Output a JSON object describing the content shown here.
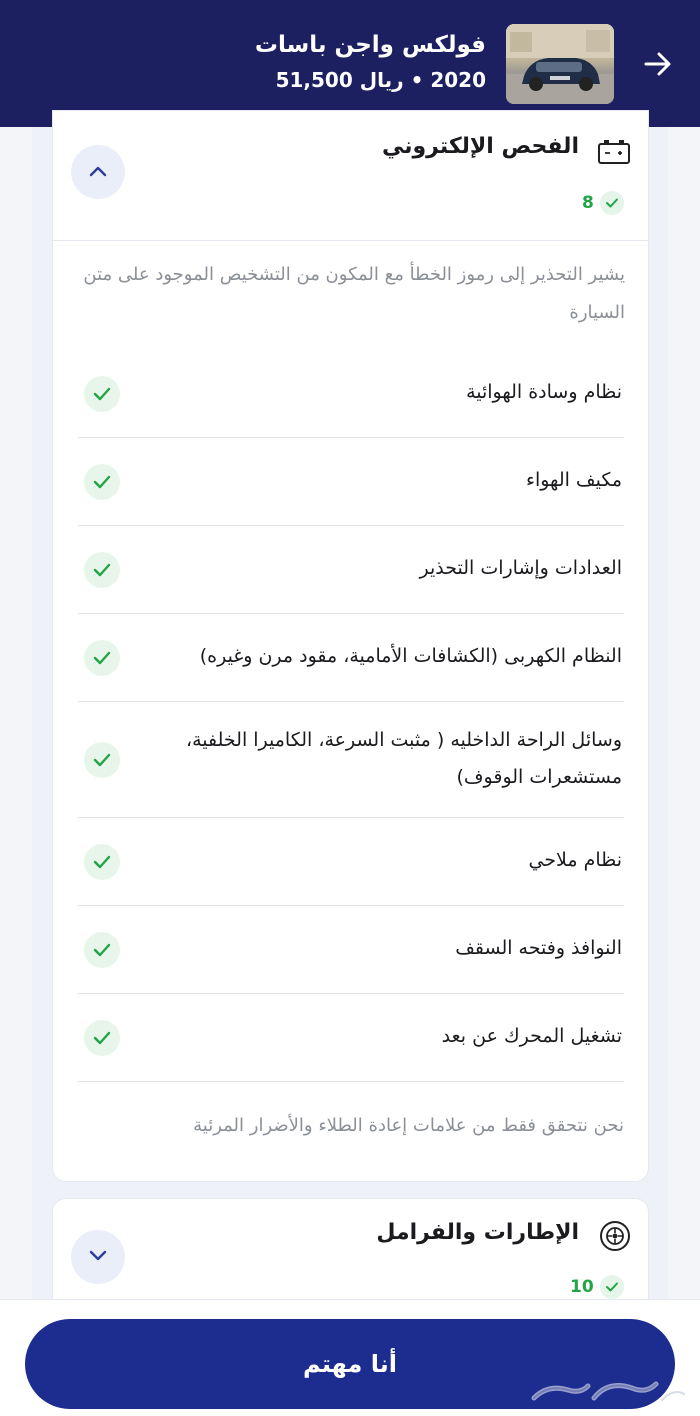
{
  "header": {
    "title": "فولكس واجن باسات",
    "subtitle": "2020 • ريال 51,500",
    "back_icon": "arrow-right-icon",
    "thumbnail_icon": "car-photo"
  },
  "electronic_section": {
    "title": "الفحص الإلكتروني",
    "icon": "battery-icon",
    "passed_count": "8",
    "description": "يشير التحذير إلى رموز الخطأ مع المكون من التشخيص الموجود على متن السيارة",
    "items": [
      {
        "label": "نظام وسادة الهوائية",
        "status": "ok"
      },
      {
        "label": "مكيف الهواء",
        "status": "ok"
      },
      {
        "label": "العدادات وإشارات التحذير",
        "status": "ok"
      },
      {
        "label": "النظام الكهربى (الكشافات الأمامية، مقود مرن وغيره)",
        "status": "ok"
      },
      {
        "label": "وسائل الراحة الداخليه ( مثبت السرعة، الكاميرا الخلفية، مستشعرات الوقوف)",
        "status": "ok"
      },
      {
        "label": "نظام ملاحي",
        "status": "ok"
      },
      {
        "label": "النوافذ وفتحه السقف",
        "status": "ok"
      },
      {
        "label": "تشغيل المحرك عن بعد",
        "status": "ok"
      }
    ],
    "note": "نحن نتحقق فقط من علامات إعادة الطلاء والأضرار المرئية"
  },
  "tyres_section": {
    "title": "الإطارات والفرامل",
    "icon": "tyre-icon",
    "passed_count": "10"
  },
  "cta": {
    "label": "أنا مهتم"
  },
  "colors": {
    "header_bg": "#1d2060",
    "cta_bg": "#1d2d8f",
    "success": "#22a447"
  }
}
